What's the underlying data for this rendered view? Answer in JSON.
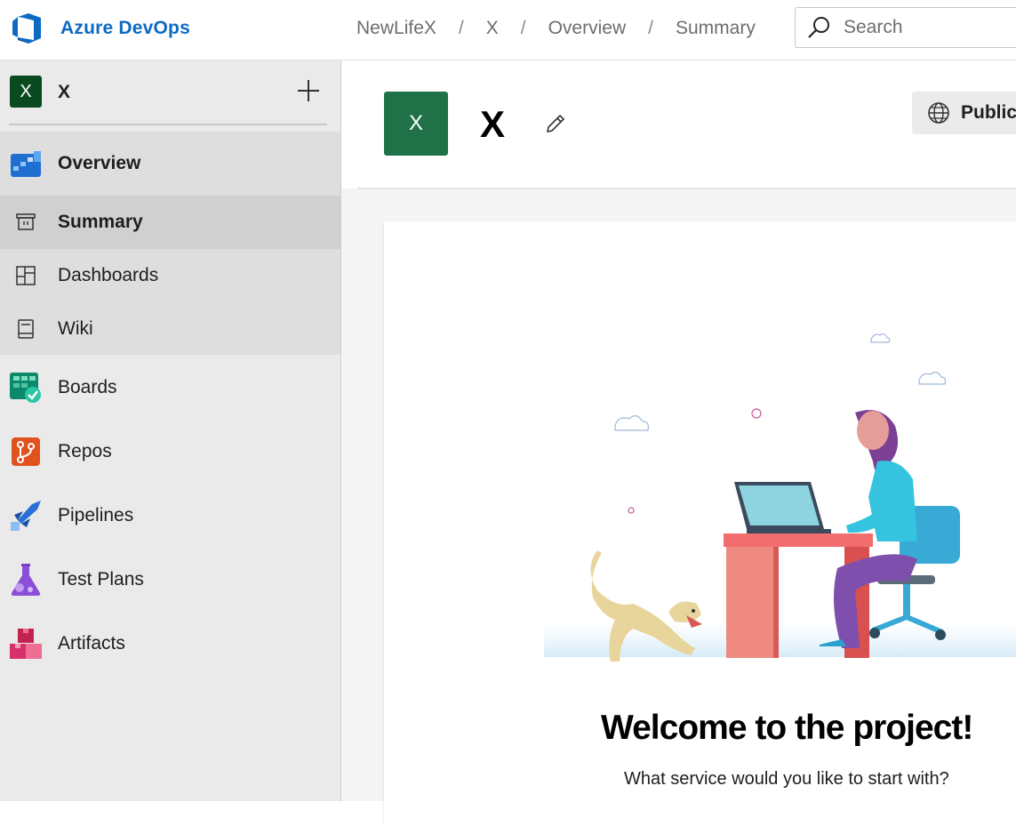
{
  "topbar": {
    "brand": "Azure DevOps",
    "breadcrumbs": [
      "NewLifeX",
      "X",
      "Overview",
      "Summary"
    ],
    "breadcrumb_separator": "/",
    "search_placeholder": "Search"
  },
  "sidebar": {
    "project_badge": "X",
    "project_name": "X",
    "items": [
      {
        "label": "Overview",
        "icon": "overview-icon"
      },
      {
        "label": "Summary",
        "icon": "summary-icon"
      },
      {
        "label": "Dashboards",
        "icon": "dashboards-icon"
      },
      {
        "label": "Wiki",
        "icon": "wiki-icon"
      },
      {
        "label": "Boards",
        "icon": "boards-icon"
      },
      {
        "label": "Repos",
        "icon": "repos-icon"
      },
      {
        "label": "Pipelines",
        "icon": "pipelines-icon"
      },
      {
        "label": "Test Plans",
        "icon": "test-plans-icon"
      },
      {
        "label": "Artifacts",
        "icon": "artifacts-icon"
      }
    ],
    "selected": "Summary"
  },
  "main": {
    "project_badge": "X",
    "project_title": "X",
    "visibility": "Public",
    "welcome_title": "Welcome to the project!",
    "welcome_subtitle": "What service would you like to start with?"
  },
  "colors": {
    "brand_blue": "#0d6ac2",
    "project_badge": "#1f7247",
    "sidebar_bg": "#eaeaea",
    "selected_bg": "#d0d0d0"
  }
}
